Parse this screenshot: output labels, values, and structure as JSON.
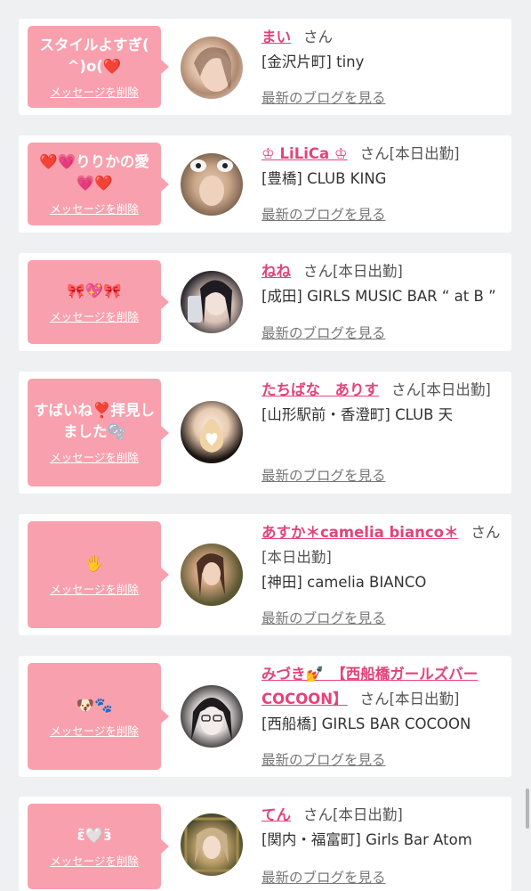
{
  "list_label": "",
  "san": "さん",
  "status": "[本日出勤]",
  "delete_label": "メッセージを削除",
  "blog_label": "最新のブログを見る",
  "colors": {
    "bubble": "#f9a0ae",
    "name": "#e4437a",
    "card": "#ffffff",
    "page": "#eef0f2"
  },
  "items": [
    {
      "message": "スタイルよすぎ( ^)o(❤️",
      "name": "まい",
      "status": "",
      "shop": "[金沢片町] tiny"
    },
    {
      "message": "❤️💗りりかの愛💗❤️",
      "name": "♔ LiLiCa ♔",
      "status": "[本日出勤]",
      "shop": "[豊橋] CLUB KING"
    },
    {
      "message": "🎀💖🎀",
      "name": "ねね",
      "status": "[本日出勤]",
      "shop": "[成田] GIRLS MUSIC BAR “ at B ”"
    },
    {
      "message": "すばいね❣️拝見しました🫧",
      "name": "たちばな　ありす",
      "status": "[本日出勤]",
      "shop": "[山形駅前・香澄町] CLUB 天"
    },
    {
      "message": "🖐️",
      "name": "あすか＊camelia bianco＊",
      "status": "[本日出勤]",
      "shop": "[神田] camelia BIANCO"
    },
    {
      "message": "🐶🐾",
      "name": "みづき💅　【西船橋ガールズバーCOCOON】",
      "status": "[本日出勤]",
      "shop": "[西船橋] GIRLS BAR COCOON"
    },
    {
      "message": "ɛ̃🤍ɜ̃",
      "name": "てん",
      "status": "[本日出勤]",
      "shop": "[関内・福富町] Girls Bar Atom"
    }
  ]
}
